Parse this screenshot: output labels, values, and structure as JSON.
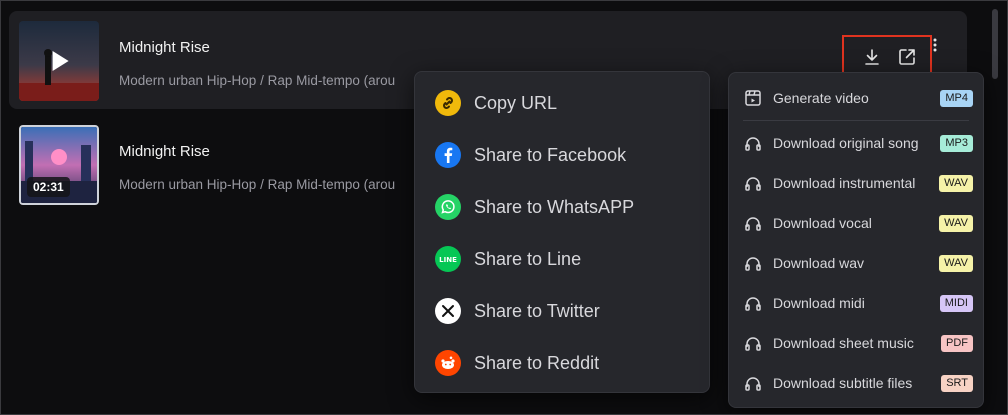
{
  "tracks": [
    {
      "title": "Midnight Rise",
      "description": "Modern urban Hip-Hop / Rap Mid-tempo (arou",
      "duration": ""
    },
    {
      "title": "Midnight Rise",
      "description": "Modern urban Hip-Hop / Rap Mid-tempo (arou",
      "duration": "02:31"
    }
  ],
  "actions": {
    "download_icon": "download-icon",
    "share_icon": "share-icon",
    "more_icon": "more-vertical-icon",
    "highlight_color": "#e0331f"
  },
  "share_menu": {
    "items": [
      {
        "label": "Copy URL",
        "icon": "link-icon",
        "color": "#f0b90b"
      },
      {
        "label": "Share to Facebook",
        "icon": "facebook-icon",
        "color": "#1877f2"
      },
      {
        "label": "Share to WhatsAPP",
        "icon": "whatsapp-icon",
        "color": "#25d366"
      },
      {
        "label": "Share to Line",
        "icon": "line-icon",
        "color": "#06c755"
      },
      {
        "label": "Share to Twitter",
        "icon": "twitter-x-icon",
        "color": "#ffffff"
      },
      {
        "label": "Share to Reddit",
        "icon": "reddit-icon",
        "color": "#ff4500"
      }
    ]
  },
  "download_menu": {
    "items": [
      {
        "label": "Generate video",
        "badge": "MP4",
        "badge_color": "#a8d4f5",
        "icon": "video-icon"
      },
      {
        "label": "Download original song",
        "badge": "MP3",
        "badge_color": "#a6ecd8",
        "icon": "headphones-icon"
      },
      {
        "label": "Download instrumental",
        "badge": "WAV",
        "badge_color": "#f5f2a8",
        "icon": "headphones-icon"
      },
      {
        "label": "Download vocal",
        "badge": "WAV",
        "badge_color": "#f5f2a8",
        "icon": "headphones-icon"
      },
      {
        "label": "Download wav",
        "badge": "WAV",
        "badge_color": "#f5f2a8",
        "icon": "headphones-icon"
      },
      {
        "label": "Download midi",
        "badge": "MIDI",
        "badge_color": "#d6c6f7",
        "icon": "headphones-icon"
      },
      {
        "label": "Download sheet music",
        "badge": "PDF",
        "badge_color": "#f7c4c4",
        "icon": "headphones-icon"
      },
      {
        "label": "Download subtitle files",
        "badge": "SRT",
        "badge_color": "#f7d2c4",
        "icon": "headphones-icon"
      }
    ]
  }
}
